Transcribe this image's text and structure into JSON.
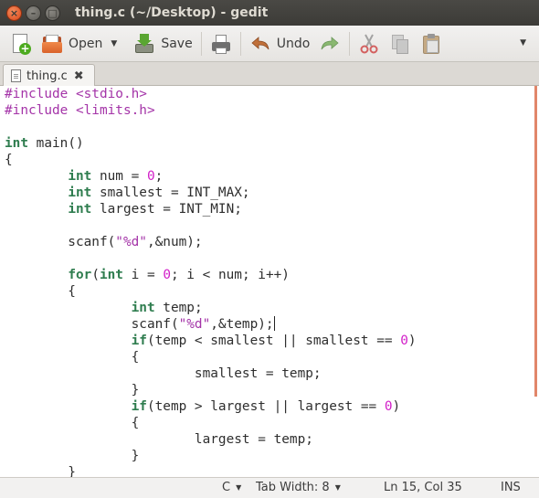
{
  "window": {
    "title": "thing.c (~/Desktop) - gedit",
    "close_glyph": "×",
    "minimize_glyph": "–",
    "maximize_glyph": "□"
  },
  "toolbar": {
    "open_label": "Open",
    "save_label": "Save",
    "undo_label": "Undo",
    "dropdown_glyph": "▼"
  },
  "tabs": [
    {
      "label": "thing.c",
      "close_glyph": "✖"
    }
  ],
  "editor": {
    "language": "c",
    "lines": [
      "#include <stdio.h>",
      "#include <limits.h>",
      "",
      "int main()",
      "{",
      "        int num = 0;",
      "        int smallest = INT_MAX;",
      "        int largest = INT_MIN;",
      "",
      "        scanf(\"%d\",&num);",
      "",
      "        for(int i = 0; i < num; i++)",
      "        {",
      "                int temp;",
      "                scanf(\"%d\",&temp);",
      "                if(temp < smallest || smallest == 0)",
      "                {",
      "                        smallest = temp;",
      "                }",
      "                if(temp > largest || largest == 0)",
      "                {",
      "                        largest = temp;",
      "                }",
      "        }"
    ],
    "cursor": {
      "line": 15,
      "col": 35
    },
    "colors": {
      "keyword": "#2f7d4f",
      "preprocessor": "#a434a8",
      "string": "#a434a8",
      "number": "#d21ec8"
    }
  },
  "statusbar": {
    "language": "C",
    "tab_width": "Tab Width: 8",
    "position": "Ln 15, Col 35",
    "mode": "INS",
    "dropdown_glyph": "▼"
  }
}
